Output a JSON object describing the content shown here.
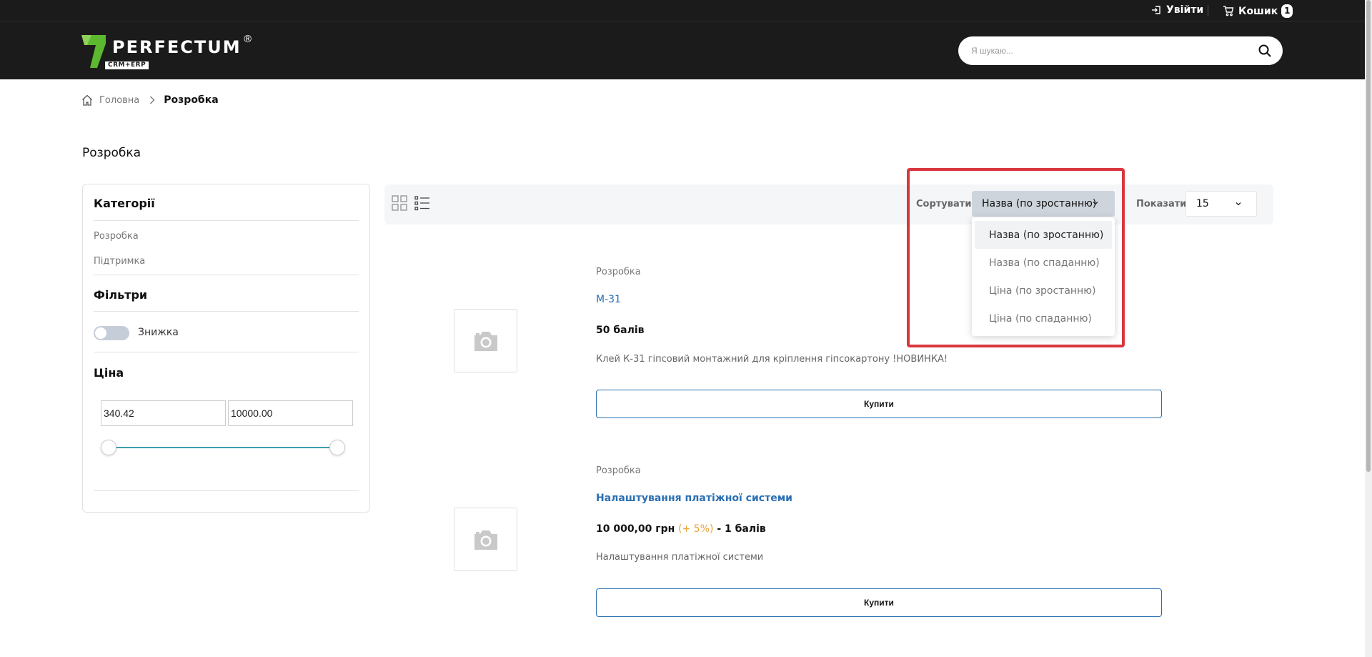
{
  "topbar": {
    "login_label": "Увійти",
    "cart_label": "Кошик",
    "cart_count": "1"
  },
  "header": {
    "logo_text": "PERFECTUM",
    "logo_sub": "CRM+ERP",
    "logo_reg": "®",
    "search_placeholder": "Я шукаю..."
  },
  "breadcrumb": {
    "home": "Головна",
    "current": "Розробка"
  },
  "page": {
    "title": "Розробка"
  },
  "sidebar": {
    "categories_title": "Категорії",
    "categories": [
      "Розробка",
      "Підтримка"
    ],
    "filters_title": "Фільтри",
    "discount_label": "Знижка",
    "price_title": "Ціна",
    "price_min": "340.42",
    "price_max": "10000.00"
  },
  "toolbar": {
    "sort_label": "Сортувати",
    "sort_selected": "Назва (по зростанню)",
    "show_label": "Показати",
    "show_selected": "15",
    "sort_options": [
      "Назва (по зростанню)",
      "Назва (по спаданню)",
      "Ціна (по зростанню)",
      "Ціна (по спаданню)"
    ]
  },
  "products": [
    {
      "category": "Розробка",
      "name": "М-31",
      "price": "50 балів",
      "description": "Клей К-31 гіпсовий монтажний для кріплення гіпсокартону !НОВИНКА!",
      "buy_label": "Купити"
    },
    {
      "category": "Розробка",
      "name": "Налаштування платіжної системи",
      "price_main": "10 000,00 грн",
      "price_plus": "(+ 5%)",
      "price_points": "- 1 балів",
      "description": "Налаштування платіжної системи",
      "buy_label": "Купити"
    }
  ],
  "colors": {
    "header_bg": "#1c1b1b",
    "accent_link": "#2a6fb3",
    "highlight": "#d9363e",
    "slider": "#3a9fb0",
    "logo_green": "#5cb82e"
  }
}
